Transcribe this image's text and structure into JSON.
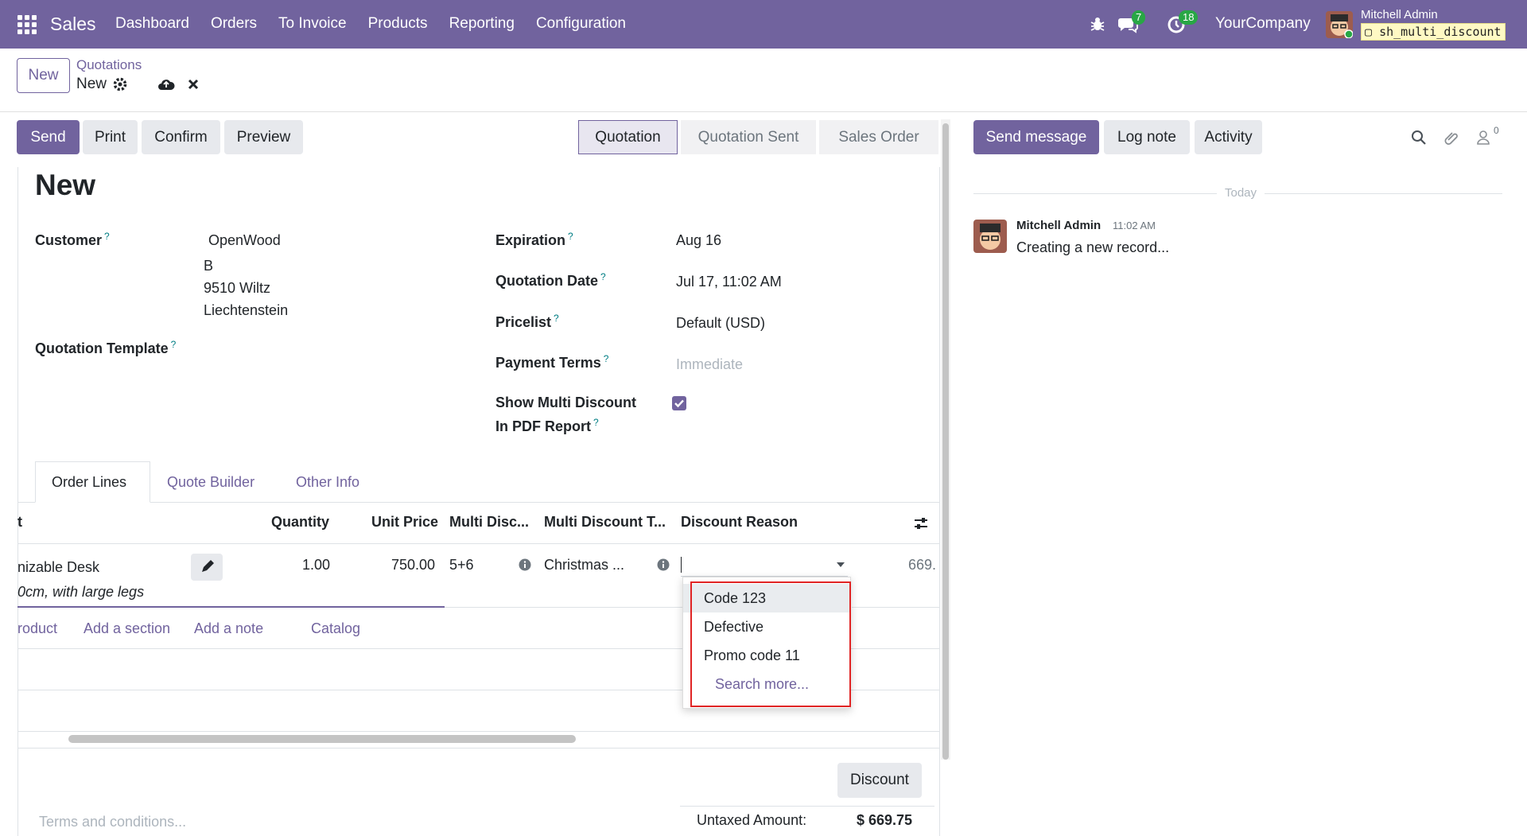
{
  "topbar": {
    "app": "Sales",
    "menu": [
      "Dashboard",
      "Orders",
      "To Invoice",
      "Products",
      "Reporting",
      "Configuration"
    ],
    "messages_count": "7",
    "activities_count": "18",
    "company": "YourCompany",
    "user": "Mitchell Admin",
    "db": "sh_multi_discount",
    "icons": [
      "apps-grid-icon",
      "bug-icon",
      "chat-icon",
      "clock-icon"
    ]
  },
  "control": {
    "new_label": "New",
    "breadcrumb_parent": "Quotations",
    "breadcrumb_current": "New"
  },
  "actions": [
    "Send",
    "Print",
    "Confirm",
    "Preview"
  ],
  "status": [
    "Quotation",
    "Quotation Sent",
    "Sales Order"
  ],
  "form": {
    "title": "New",
    "customer_label": "Customer",
    "customer_name": "OpenWood",
    "customer_addr": [
      "B",
      "9510 Wiltz",
      "Liechtenstein"
    ],
    "template_label": "Quotation Template",
    "expiration_label": "Expiration",
    "expiration": "Aug 16",
    "qdate_label": "Quotation Date",
    "qdate": "Jul 17, 11:02 AM",
    "pricelist_label": "Pricelist",
    "pricelist": "Default (USD)",
    "payterms_label": "Payment Terms",
    "payterms_placeholder": "Immediate",
    "multidisc_label_1": "Show Multi Discount",
    "multidisc_label_2": "In PDF Report",
    "multidisc_checked": true
  },
  "tabs": [
    "Order Lines",
    "Quote Builder",
    "Other Info"
  ],
  "table": {
    "headers": [
      "t",
      "Quantity",
      "Unit Price",
      "Multi Disc...",
      "Multi Discount T...",
      "Discount Reason"
    ],
    "row": {
      "product": "nizable Desk",
      "desc": "0cm, with large legs",
      "qty": "1.00",
      "price": "750.00",
      "multi_disc": "5+6",
      "multi_type": "Christmas ...",
      "subtotal": "669."
    },
    "add_links": [
      "roduct",
      "Add a section",
      "Add a note",
      "Catalog"
    ]
  },
  "dropdown": [
    "Code 123",
    "Defective",
    "Promo code 11",
    "Search more..."
  ],
  "footer": {
    "terms_placeholder": "Terms and conditions...",
    "discount_btn": "Discount",
    "untaxed_label": "Untaxed Amount:",
    "untaxed_value": "$ 669.75"
  },
  "chatter": {
    "send_message": "Send message",
    "log_note": "Log note",
    "activity": "Activity",
    "followers_count": "0",
    "today": "Today",
    "author": "Mitchell Admin",
    "time": "11:02 AM",
    "message": "Creating a new record..."
  },
  "colors": {
    "brand": "#71639e",
    "link": "#71639e",
    "highlight": "#e02424"
  }
}
